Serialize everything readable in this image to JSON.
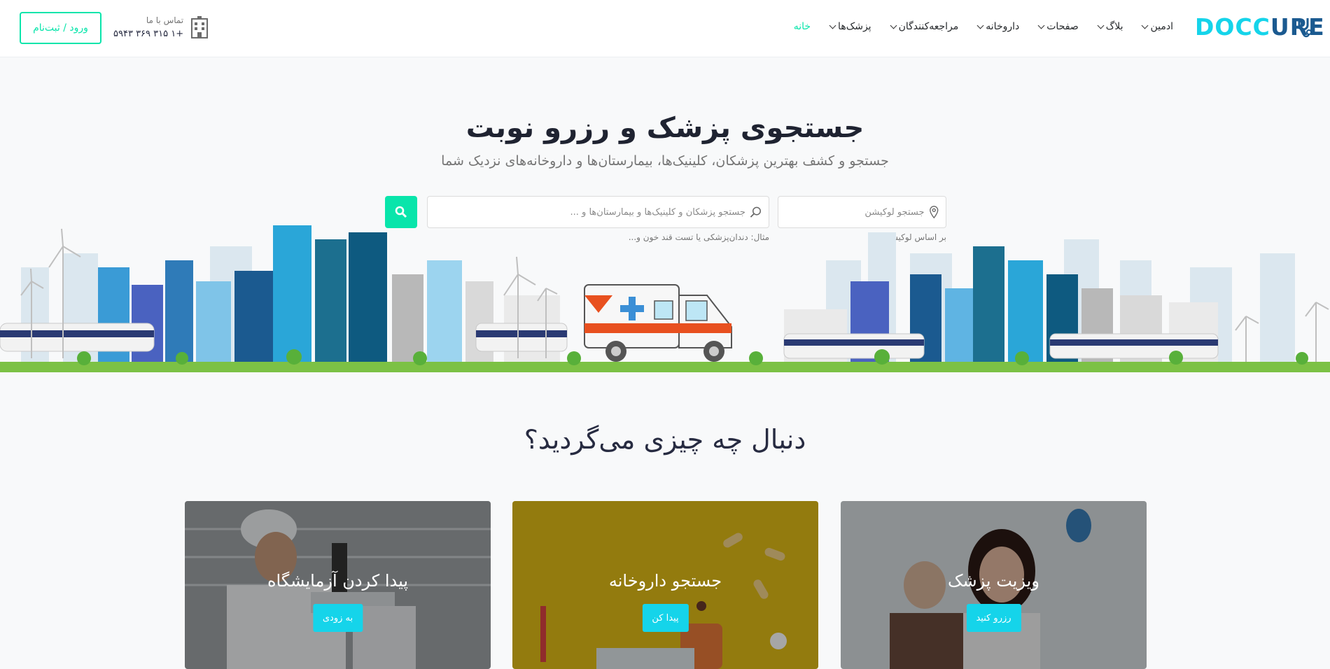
{
  "logo": {
    "part1": "DOCC",
    "part2": "U",
    "part3": "RE"
  },
  "nav": {
    "items": [
      {
        "label": "خانه",
        "active": true,
        "dropdown": false
      },
      {
        "label": "پزشک‌ها",
        "active": false,
        "dropdown": true
      },
      {
        "label": "مراجعه‌کنندگان",
        "active": false,
        "dropdown": true
      },
      {
        "label": "داروخانه",
        "active": false,
        "dropdown": true
      },
      {
        "label": "صفحات",
        "active": false,
        "dropdown": true
      },
      {
        "label": "بلاگ",
        "active": false,
        "dropdown": true
      },
      {
        "label": "ادمین",
        "active": false,
        "dropdown": true
      }
    ]
  },
  "contact": {
    "label": "تماس با ما",
    "phone": "+۱ ۳۱۵ ۳۶۹ ۵۹۴۳",
    "icon": "hospital-building-icon"
  },
  "auth": {
    "login_label": "ورود / ثبت‌نام"
  },
  "hero": {
    "title": "جستجوی پزشک و رزرو نوبت",
    "subtitle": "جستجو و کشف بهترین پزشکان، کلینیک‌ها، بیمارستان‌ها و داروخانه‌های نزدیک شما",
    "location_placeholder": "جستجو لوکیشن",
    "location_hint": "بر اساس لوکیشن",
    "keyword_placeholder": "جستجو پزشکان و کلینیک‌ها و بیمارستان‌ها و ...",
    "keyword_hint": "مثال: دندان‌پزشکی یا تست قند خون و..."
  },
  "section": {
    "title": "دنبال چه چیزی می‌گردید؟"
  },
  "cards": [
    {
      "title": "ویزیت پزشک",
      "button": "رزرو کنید"
    },
    {
      "title": "جستجو داروخانه",
      "button": "پیدا کن"
    },
    {
      "title": "پیدا کردن آزمایشگاه",
      "button": "به زودی"
    }
  ],
  "colors": {
    "accent": "#09e5ab",
    "brand_cyan": "#15d4ea",
    "brand_dark": "#1b5a90"
  }
}
